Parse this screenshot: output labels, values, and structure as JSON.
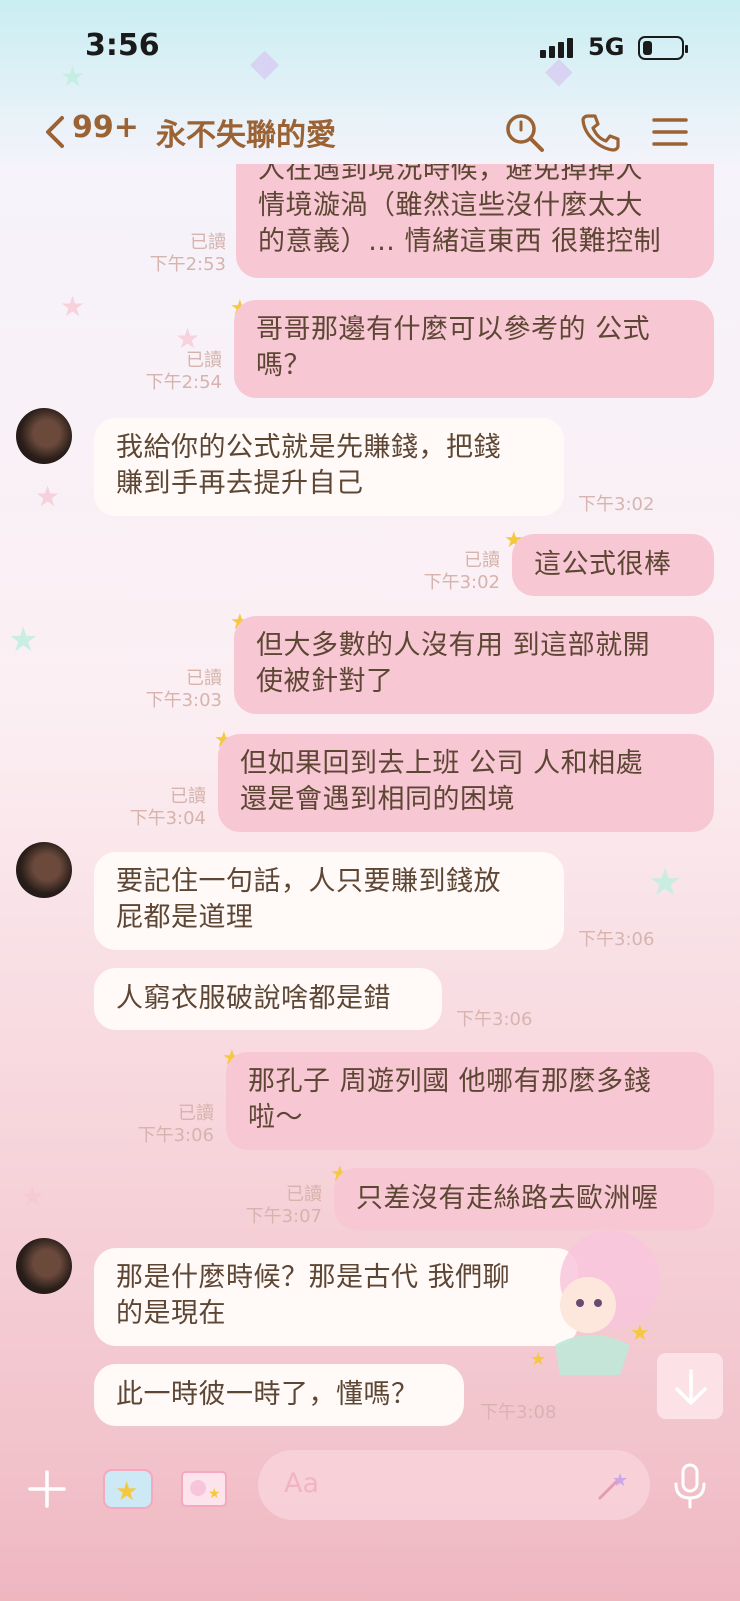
{
  "status_bar": {
    "time": "3:56",
    "network": "5G"
  },
  "header": {
    "unread_count": "99+",
    "title": "永不失聯的愛"
  },
  "messages": [
    {
      "side": "right",
      "lines": [
        "人在遇到境況時候，避免掉掉人",
        "情境漩渦（雖然這些沒什麼太大",
        "的意義）… 情緒這東西 很難控制"
      ],
      "read": "已讀",
      "time": "下午2:53"
    },
    {
      "side": "right",
      "lines": [
        "哥哥那邊有什麼可以參考的 公式",
        "嗎？"
      ],
      "read": "已讀",
      "time": "下午2:54"
    },
    {
      "side": "left",
      "lines": [
        "我給你的公式就是先賺錢，把錢",
        "賺到手再去提升自己"
      ],
      "time": "下午3:02"
    },
    {
      "side": "right",
      "lines": [
        "這公式很棒"
      ],
      "read": "已讀",
      "time": "下午3:02"
    },
    {
      "side": "right",
      "lines": [
        "但大多數的人沒有用 到這部就開",
        "使被針對了"
      ],
      "read": "已讀",
      "time": "下午3:03"
    },
    {
      "side": "right",
      "lines": [
        "但如果回到去上班 公司 人和相處",
        "還是會遇到相同的困境"
      ],
      "read": "已讀",
      "time": "下午3:04"
    },
    {
      "side": "left",
      "lines": [
        "要記住一句話，人只要賺到錢放",
        "屁都是道理"
      ],
      "time": "下午3:06"
    },
    {
      "side": "left",
      "lines": [
        "人窮衣服破說啥都是錯"
      ],
      "time": "下午3:06"
    },
    {
      "side": "right",
      "lines": [
        "那孔子 周遊列國 他哪有那麼多錢",
        "啦～"
      ],
      "read": "已讀",
      "time": "下午3:06"
    },
    {
      "side": "right",
      "lines": [
        "只差沒有走絲路去歐洲喔"
      ],
      "read": "已讀",
      "time": "下午3:07"
    },
    {
      "side": "left",
      "lines": [
        "那是什麼時候？那是古代  我們聊",
        "的是現在"
      ],
      "time": ""
    },
    {
      "side": "left",
      "lines": [
        "此一時彼一時了，懂嗎？"
      ],
      "time": "下午3:08"
    }
  ],
  "input": {
    "placeholder": "Aa"
  },
  "icons": {
    "back": "chevron-left-icon",
    "search": "search-icon",
    "call": "phone-icon",
    "menu": "hamburger-menu-icon",
    "plus": "plus-icon",
    "mic": "microphone-icon",
    "scroll_down": "arrow-down-icon"
  },
  "colors": {
    "accent": "#9b6233",
    "my_bubble": "#f7c8d4",
    "their_bubble": "#fffaf8"
  }
}
